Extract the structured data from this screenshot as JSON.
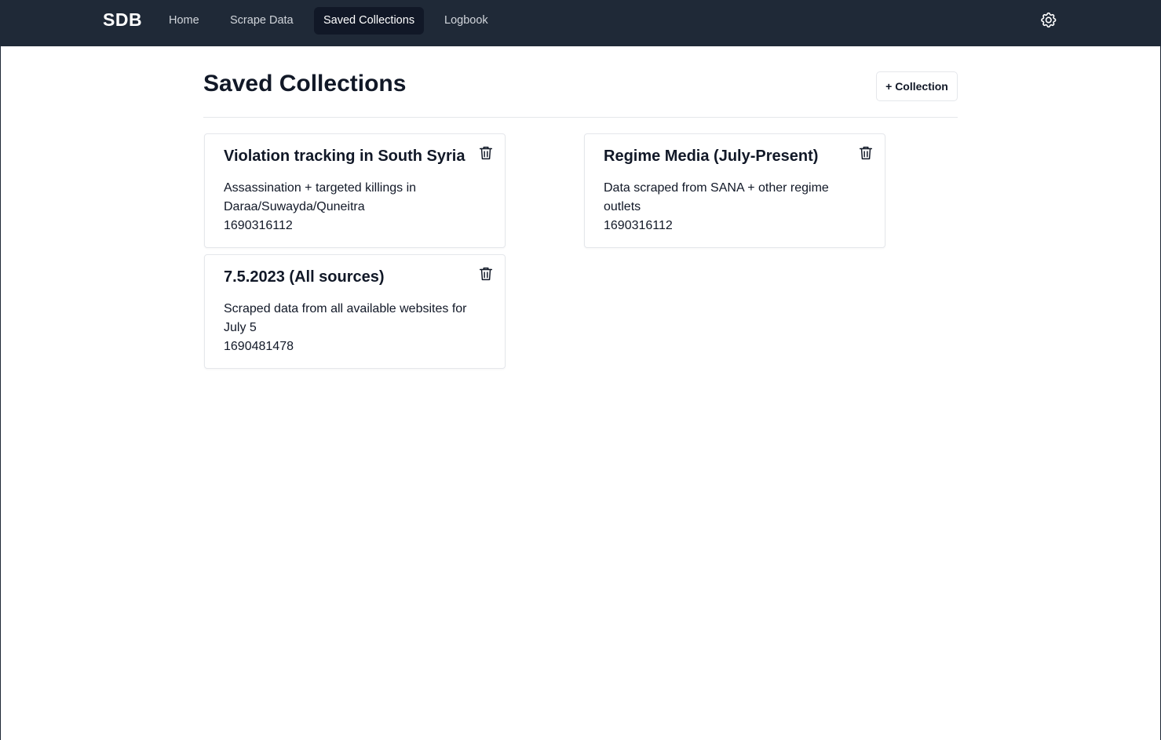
{
  "nav": {
    "brand": "SDB",
    "links": [
      {
        "label": "Home"
      },
      {
        "label": "Scrape Data"
      },
      {
        "label": "Saved Collections"
      },
      {
        "label": "Logbook"
      }
    ],
    "settings_icon": "gear-icon"
  },
  "page": {
    "title": "Saved Collections",
    "add_button": "+ Collection"
  },
  "collections": [
    {
      "title": "Violation tracking in South Syria",
      "description": "Assassination + targeted killings in Daraa/Suwayda/Quneitra",
      "timestamp": "1690316112"
    },
    {
      "title": "Regime Media (July-Present)",
      "description": "Data scraped from SANA + other regime outlets",
      "timestamp": "1690316112"
    },
    {
      "title": "7.5.2023 (All sources)",
      "description": "Scraped data from all available websites for July 5",
      "timestamp": "1690481478"
    }
  ],
  "colors": {
    "navbar_bg": "#1f2937",
    "active_tab_bg": "#111827",
    "nav_text": "#d1d5db",
    "border": "#e5e7eb"
  }
}
